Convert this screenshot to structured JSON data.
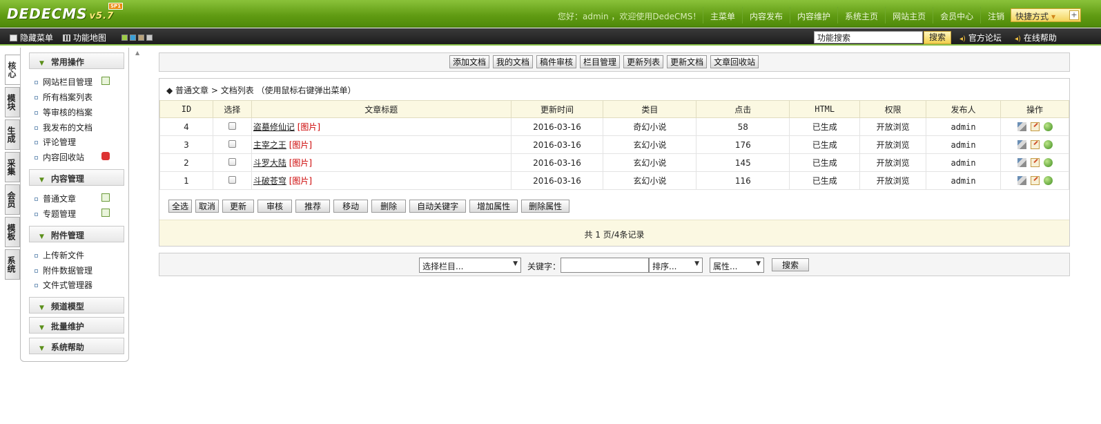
{
  "header": {
    "logo": "DEDECMS",
    "version": "v5.7",
    "edition_badge": "SP1",
    "welcome": "您好：admin ，欢迎使用DedeCMS！",
    "nav": [
      "主菜单",
      "内容发布",
      "内容维护",
      "系统主页",
      "网站主页",
      "会员中心",
      "注销"
    ],
    "quick_menu": "快捷方式"
  },
  "subbar": {
    "hide_menu": "隐藏菜单",
    "function_map": "功能地图",
    "skins": [
      "#9ccc44",
      "#3aa0d8",
      "#b8a27a",
      "#c8c8c8"
    ],
    "search_value": "功能搜索",
    "search_button": "搜索",
    "forum": "官方论坛",
    "help": "在线帮助"
  },
  "vtabs": [
    "核心",
    "模块",
    "生成",
    "采集",
    "会员",
    "模板",
    "系统"
  ],
  "leftmenu": {
    "groups": {
      "common": "常用操作",
      "content": "内容管理",
      "attach": "附件管理",
      "channel": "频道模型",
      "batch": "批量维护",
      "help": "系统帮助"
    },
    "common_items": [
      "网站栏目管理",
      "所有档案列表",
      "等审核的档案",
      "我发布的文档",
      "评论管理",
      "内容回收站"
    ],
    "content_items": [
      "普通文章",
      "专题管理"
    ],
    "attach_items": [
      "上传新文件",
      "附件数据管理",
      "文件式管理器"
    ]
  },
  "toolbar": [
    "添加文档",
    "我的文档",
    "稿件审核",
    "栏目管理",
    "更新列表",
    "更新文档",
    "文章回收站"
  ],
  "breadcrumb": "◆ 普通文章 > 文档列表 （使用鼠标右键弹出菜单）",
  "table": {
    "headers": [
      "ID",
      "选择",
      "文章标题",
      "更新时间",
      "类目",
      "点击",
      "HTML",
      "权限",
      "发布人",
      "操作"
    ],
    "rows": [
      {
        "id": "4",
        "title": "盗墓修仙记",
        "pic": "[图片]",
        "date": "2016-03-16",
        "category": "奇幻小说",
        "clicks": "58",
        "html": "已生成",
        "perm": "开放浏览",
        "author": "admin"
      },
      {
        "id": "3",
        "title": "主宰之王",
        "pic": "[图片]",
        "date": "2016-03-16",
        "category": "玄幻小说",
        "clicks": "176",
        "html": "已生成",
        "perm": "开放浏览",
        "author": "admin"
      },
      {
        "id": "2",
        "title": "斗罗大陆",
        "pic": "[图片]",
        "date": "2016-03-16",
        "category": "玄幻小说",
        "clicks": "145",
        "html": "已生成",
        "perm": "开放浏览",
        "author": "admin"
      },
      {
        "id": "1",
        "title": "斗破苍穹",
        "pic": "[图片]",
        "date": "2016-03-16",
        "category": "玄幻小说",
        "clicks": "116",
        "html": "已生成",
        "perm": "开放浏览",
        "author": "admin"
      }
    ]
  },
  "actions": [
    "全选",
    "取消",
    "更新",
    "审核",
    "推荐",
    "移动",
    "删除",
    "自动关键字",
    "增加属性",
    "删除属性"
  ],
  "pager": "共 1 页/4条记录",
  "search": {
    "category_select": "选择栏目...",
    "keyword_label": "关键字：",
    "keyword_value": "",
    "sort_select": "排序...",
    "attr_select": "属性...",
    "button": "搜索"
  }
}
